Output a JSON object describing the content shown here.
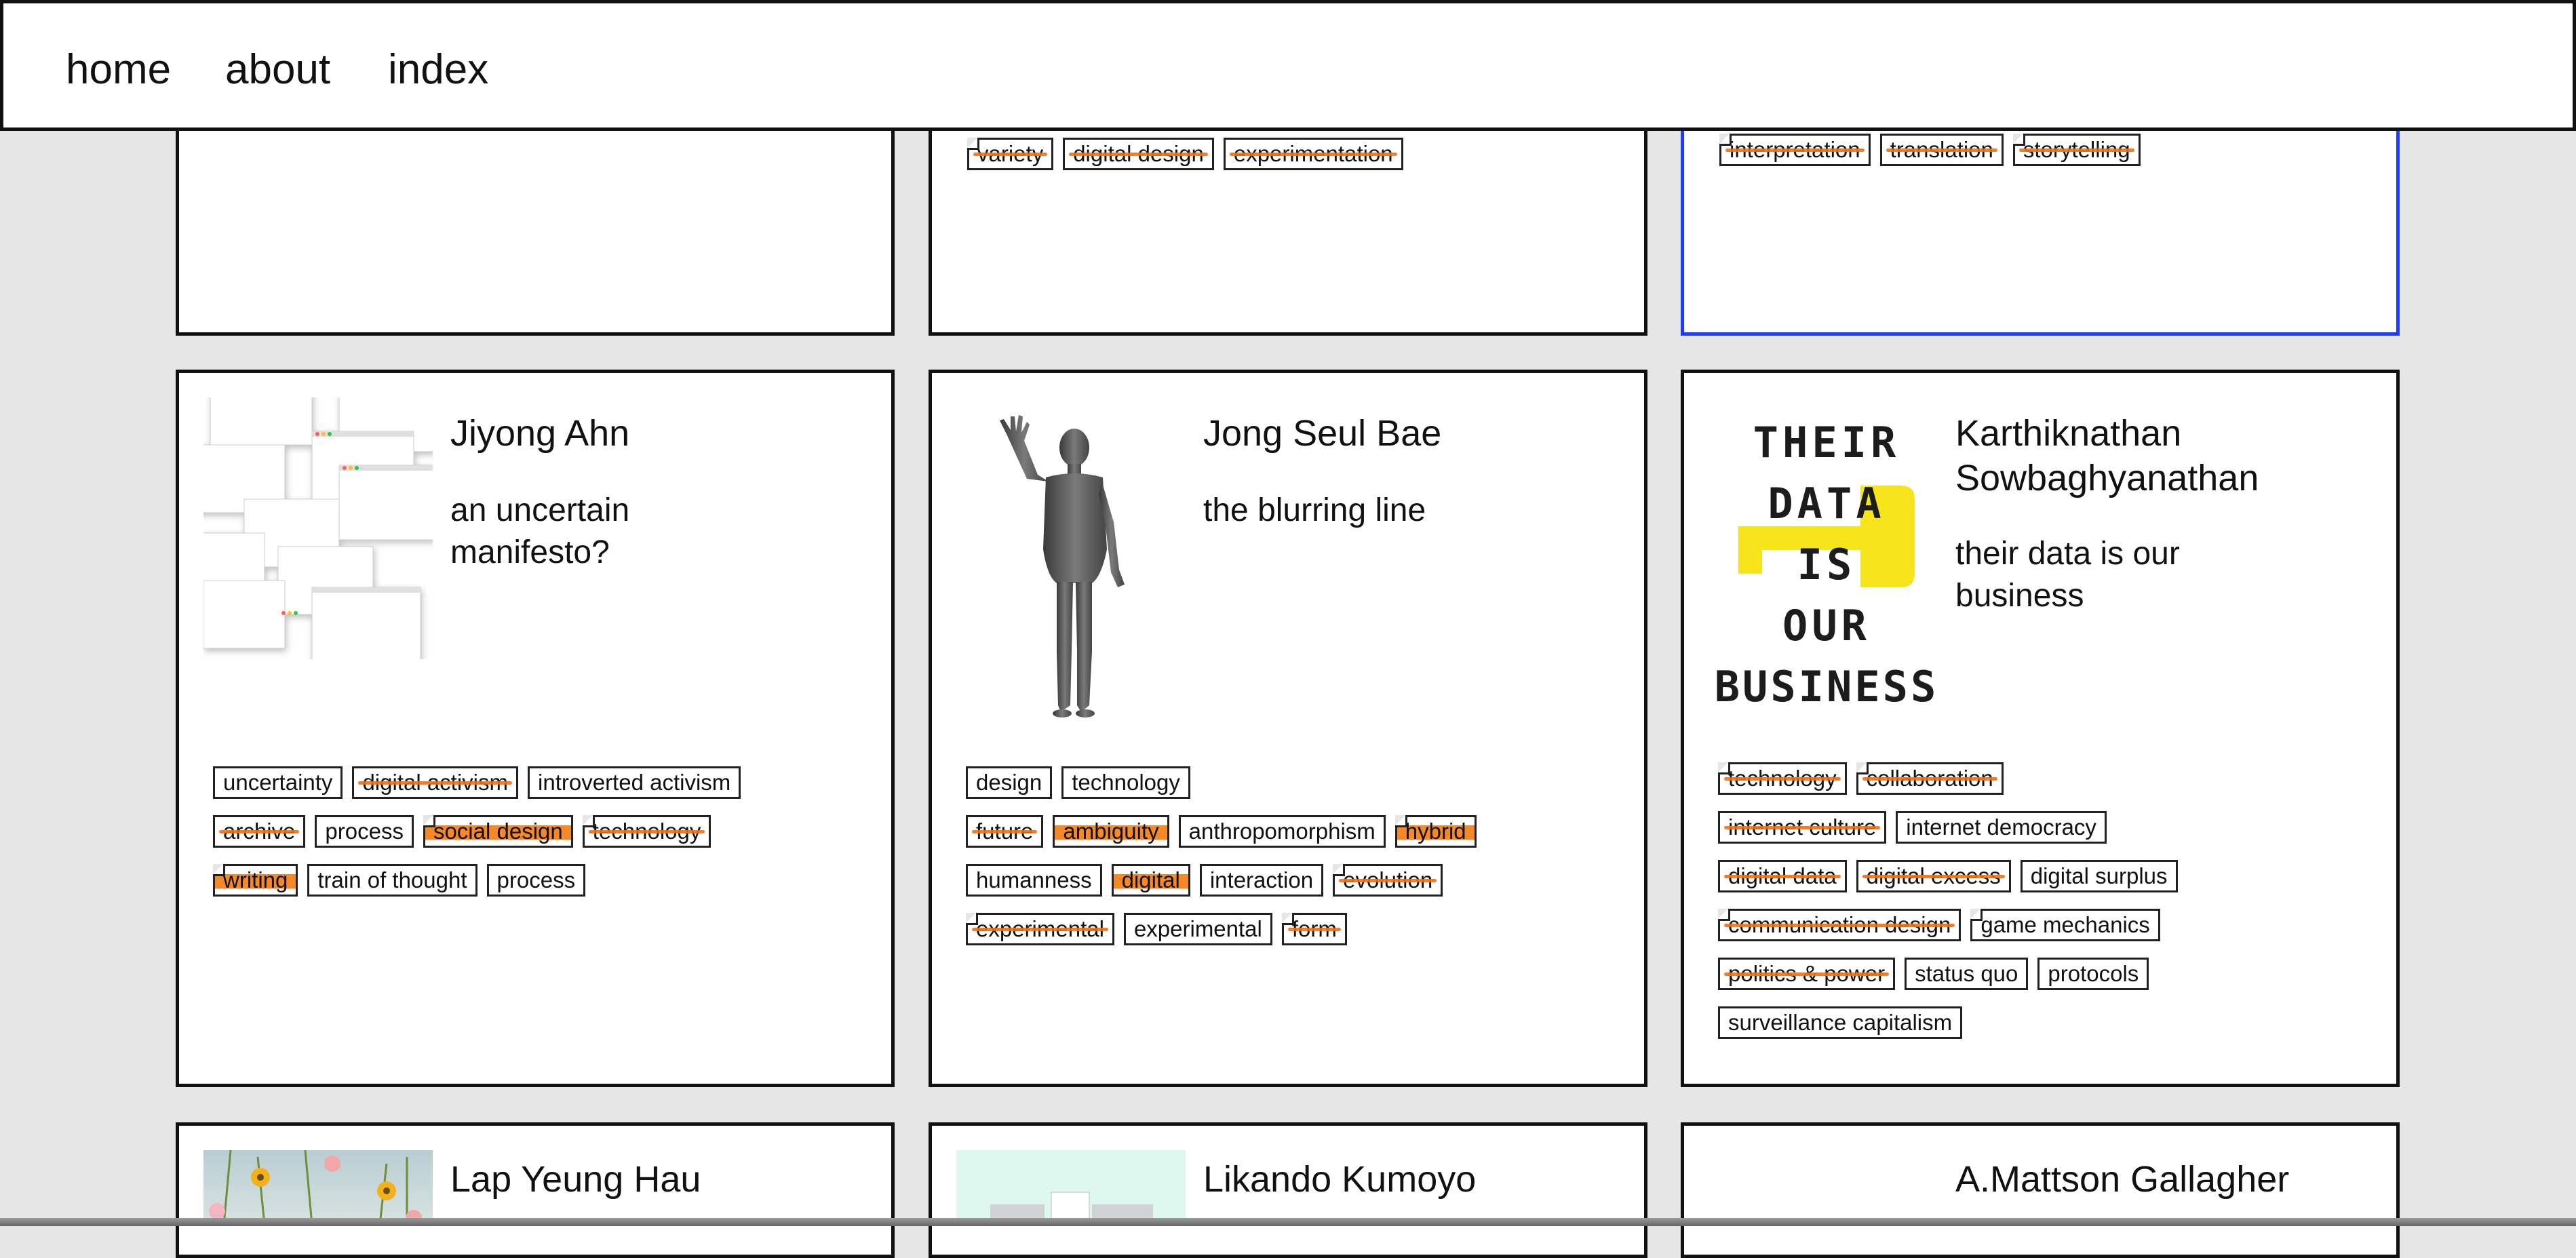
{
  "nav": {
    "items": [
      "home",
      "about",
      "index"
    ]
  },
  "top_row": [
    {
      "tags": []
    },
    {
      "tags": [
        {
          "label": "variety",
          "style": "struck folded"
        },
        {
          "label": "digital design",
          "style": "struck"
        },
        {
          "label": "experimentation",
          "style": "struck"
        }
      ]
    },
    {
      "selected": true,
      "tags": [
        {
          "label": "interpretation",
          "style": "struck folded"
        },
        {
          "label": "translation",
          "style": "struck"
        },
        {
          "label": "storytelling",
          "style": "struck folded"
        }
      ]
    }
  ],
  "middle_row": [
    {
      "name": "Jiyong Ahn",
      "title": "an uncertain manifesto?",
      "thumb": "windows-collage",
      "tags": [
        {
          "label": "uncertainty",
          "style": ""
        },
        {
          "label": "digital activism",
          "style": "struck"
        },
        {
          "label": "introverted activism",
          "style": ""
        },
        {
          "label": "archive",
          "style": "struck"
        },
        {
          "label": "process",
          "style": ""
        },
        {
          "label": "social design",
          "style": "marked folded"
        },
        {
          "label": "technology",
          "style": "struck folded"
        },
        {
          "label": "writing",
          "style": "marked folded"
        },
        {
          "label": "train of thought",
          "style": ""
        },
        {
          "label": "process",
          "style": ""
        }
      ]
    },
    {
      "name": "Jong Seul Bae",
      "title": "the blurring line",
      "thumb": "waving-figure",
      "tags": [
        {
          "label": "design",
          "style": ""
        },
        {
          "label": "technology",
          "style": ""
        },
        {
          "label": "future",
          "style": "struck"
        },
        {
          "label": "ambiguity",
          "style": "marked"
        },
        {
          "label": "anthropomorphism",
          "style": ""
        },
        {
          "label": "hybrid",
          "style": "marked folded"
        },
        {
          "label": "humanness",
          "style": ""
        },
        {
          "label": "digital",
          "style": "marked"
        },
        {
          "label": "interaction",
          "style": ""
        },
        {
          "label": "evolution",
          "style": "struck folded"
        },
        {
          "label": "experimental",
          "style": "struck folded"
        },
        {
          "label": "experimental",
          "style": ""
        },
        {
          "label": "form",
          "style": "struck folded"
        }
      ]
    },
    {
      "name": "Karthiknathan Sowbaghyanathan",
      "title": "their data is our business",
      "thumb": "poster-their-data",
      "poster_lines": [
        "THEIR",
        "DATA",
        "IS",
        "OUR",
        "BUSINESS"
      ],
      "tags": [
        {
          "label": "technology",
          "style": "struck folded"
        },
        {
          "label": "collaboration",
          "style": "struck folded"
        },
        {
          "label": "internet culture",
          "style": "struck"
        },
        {
          "label": "internet democracy",
          "style": ""
        },
        {
          "label": "digital data",
          "style": "struck"
        },
        {
          "label": "digital excess",
          "style": "struck"
        },
        {
          "label": "digital surplus",
          "style": ""
        },
        {
          "label": "communication design",
          "style": "struck folded"
        },
        {
          "label": "game mechanics",
          "style": "folded"
        },
        {
          "label": "politics & power",
          "style": "struck"
        },
        {
          "label": "status quo",
          "style": ""
        },
        {
          "label": "protocols",
          "style": ""
        },
        {
          "label": "surveillance capitalism",
          "style": ""
        }
      ]
    }
  ],
  "bottom_row": [
    {
      "name": "Lap Yeung Hau",
      "thumb": "flowers"
    },
    {
      "name": "Likando Kumoyo",
      "thumb": "mint-screens"
    },
    {
      "name": "A.Mattson Gallagher",
      "thumb": "dark-lines"
    }
  ],
  "colors": {
    "accent": "#f07013",
    "selected_border": "#1e3cff",
    "poster_yellow": "#f7e51b",
    "background": "#e6e6e6"
  }
}
